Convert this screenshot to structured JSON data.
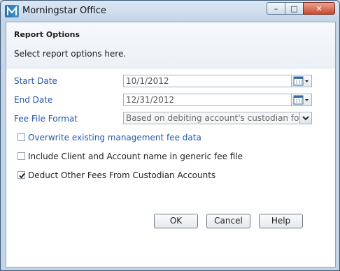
{
  "window": {
    "title": "Morningstar Office",
    "minimize_symbol": "–",
    "maximize_symbol": "□",
    "close_symbol": "✕"
  },
  "header": {
    "title": "Report Options",
    "subtitle": "Select report options here."
  },
  "form": {
    "start_date": {
      "label": "Start Date",
      "value": "10/1/2012"
    },
    "end_date": {
      "label": "End Date",
      "value": "12/31/2012"
    },
    "fee_file_format": {
      "label": "Fee File Format",
      "value": "Based on debiting account's custodian format"
    }
  },
  "options": [
    {
      "label": "Overwrite existing management fee data",
      "checked": false
    },
    {
      "label": "Include Client and Account name in generic fee file",
      "checked": false
    },
    {
      "label": "Deduct Other Fees From Custodian Accounts",
      "checked": true
    }
  ],
  "buttons": {
    "ok": "OK",
    "cancel": "Cancel",
    "help": "Help"
  },
  "icons": [
    "morningstar-logo-icon",
    "calendar-icon",
    "chevron-down-icon",
    "checkmark-icon"
  ],
  "colors": {
    "label_blue": "#2457a8",
    "frame": "#c4d5e8",
    "close_red": "#c84a2f"
  }
}
